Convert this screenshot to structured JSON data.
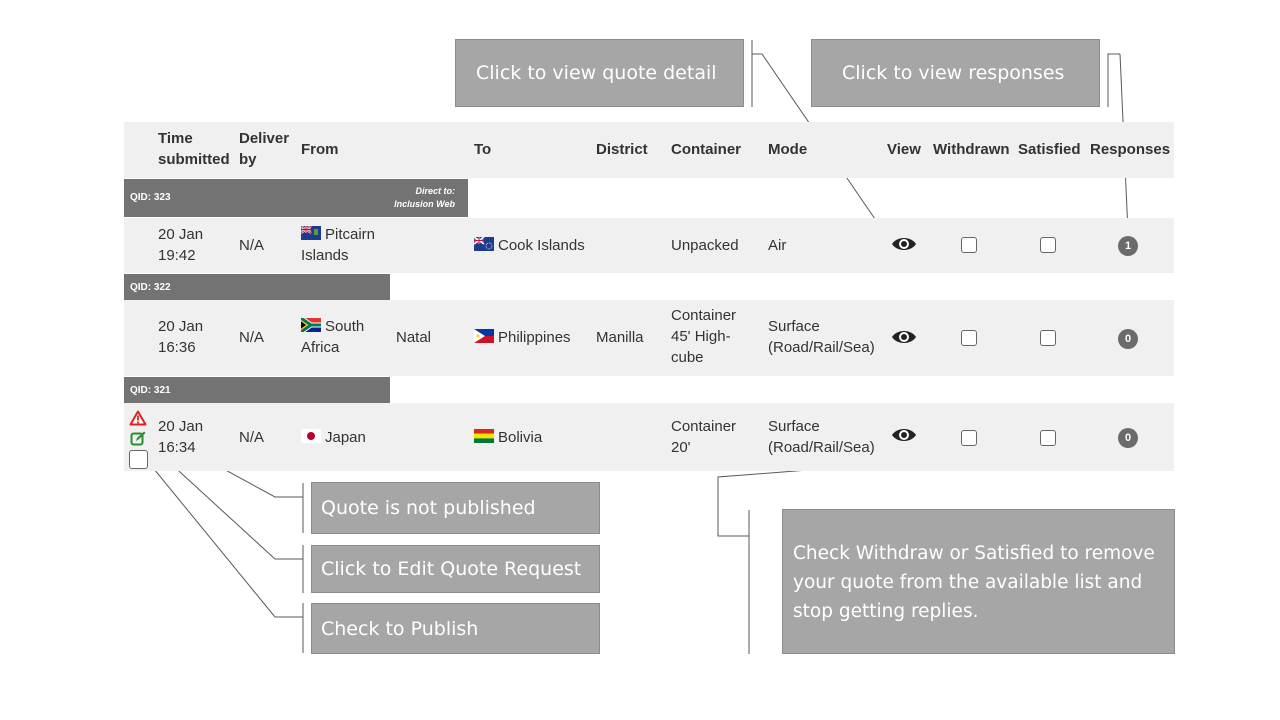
{
  "callouts": {
    "view_detail": "Click to view quote detail",
    "view_responses": "Click to view responses",
    "not_published": "Quote is not published",
    "edit_request": "Click to Edit Quote Request",
    "publish": "Check to Publish",
    "withdraw_info": "Check Withdraw or Satisfied to remove your quote from the available list and stop getting replies."
  },
  "table": {
    "headers": {
      "time": "Time submitted",
      "deliver": "Deliver by",
      "from": "From",
      "to": "To",
      "district": "District",
      "container": "Container",
      "mode": "Mode",
      "view": "View",
      "withdrawn": "Withdrawn",
      "satisfied": "Satisfied",
      "responses": "Responses"
    },
    "quotes": [
      {
        "qid": "QID: 323",
        "direct_to": "Direct to: Inclusion Web",
        "time": "20 Jan 19:42",
        "deliver": "N/A",
        "from": "Pitcairn Islands",
        "from_district": "",
        "to": "Cook Islands",
        "district": "",
        "container": "Unpacked",
        "mode": "Air",
        "responses": "1"
      },
      {
        "qid": "QID: 322",
        "direct_to": "",
        "time": "20 Jan 16:36",
        "deliver": "N/A",
        "from": "South Africa",
        "from_district": "Natal",
        "to": "Philippines",
        "district": "Manilla",
        "container": "Container 45' High-cube",
        "mode": "Surface (Road/Rail/Sea)",
        "responses": "0"
      },
      {
        "qid": "QID: 321",
        "direct_to": "",
        "time": "20 Jan 16:34",
        "deliver": "N/A",
        "from": "Japan",
        "from_district": "",
        "to": "Bolivia",
        "district": "",
        "container": "Container 20'",
        "mode": "Surface (Road/Rail/Sea)",
        "responses": "0"
      }
    ]
  },
  "icons": {
    "warning": "warning-triangle-icon",
    "edit": "edit-icon",
    "view": "eye-icon"
  },
  "colors": {
    "callout_bg": "#a6a6a6",
    "qid_bar": "#737373",
    "row_bg": "#f0f0f0",
    "warning": "#e02020",
    "edit": "#2e8b2e"
  }
}
